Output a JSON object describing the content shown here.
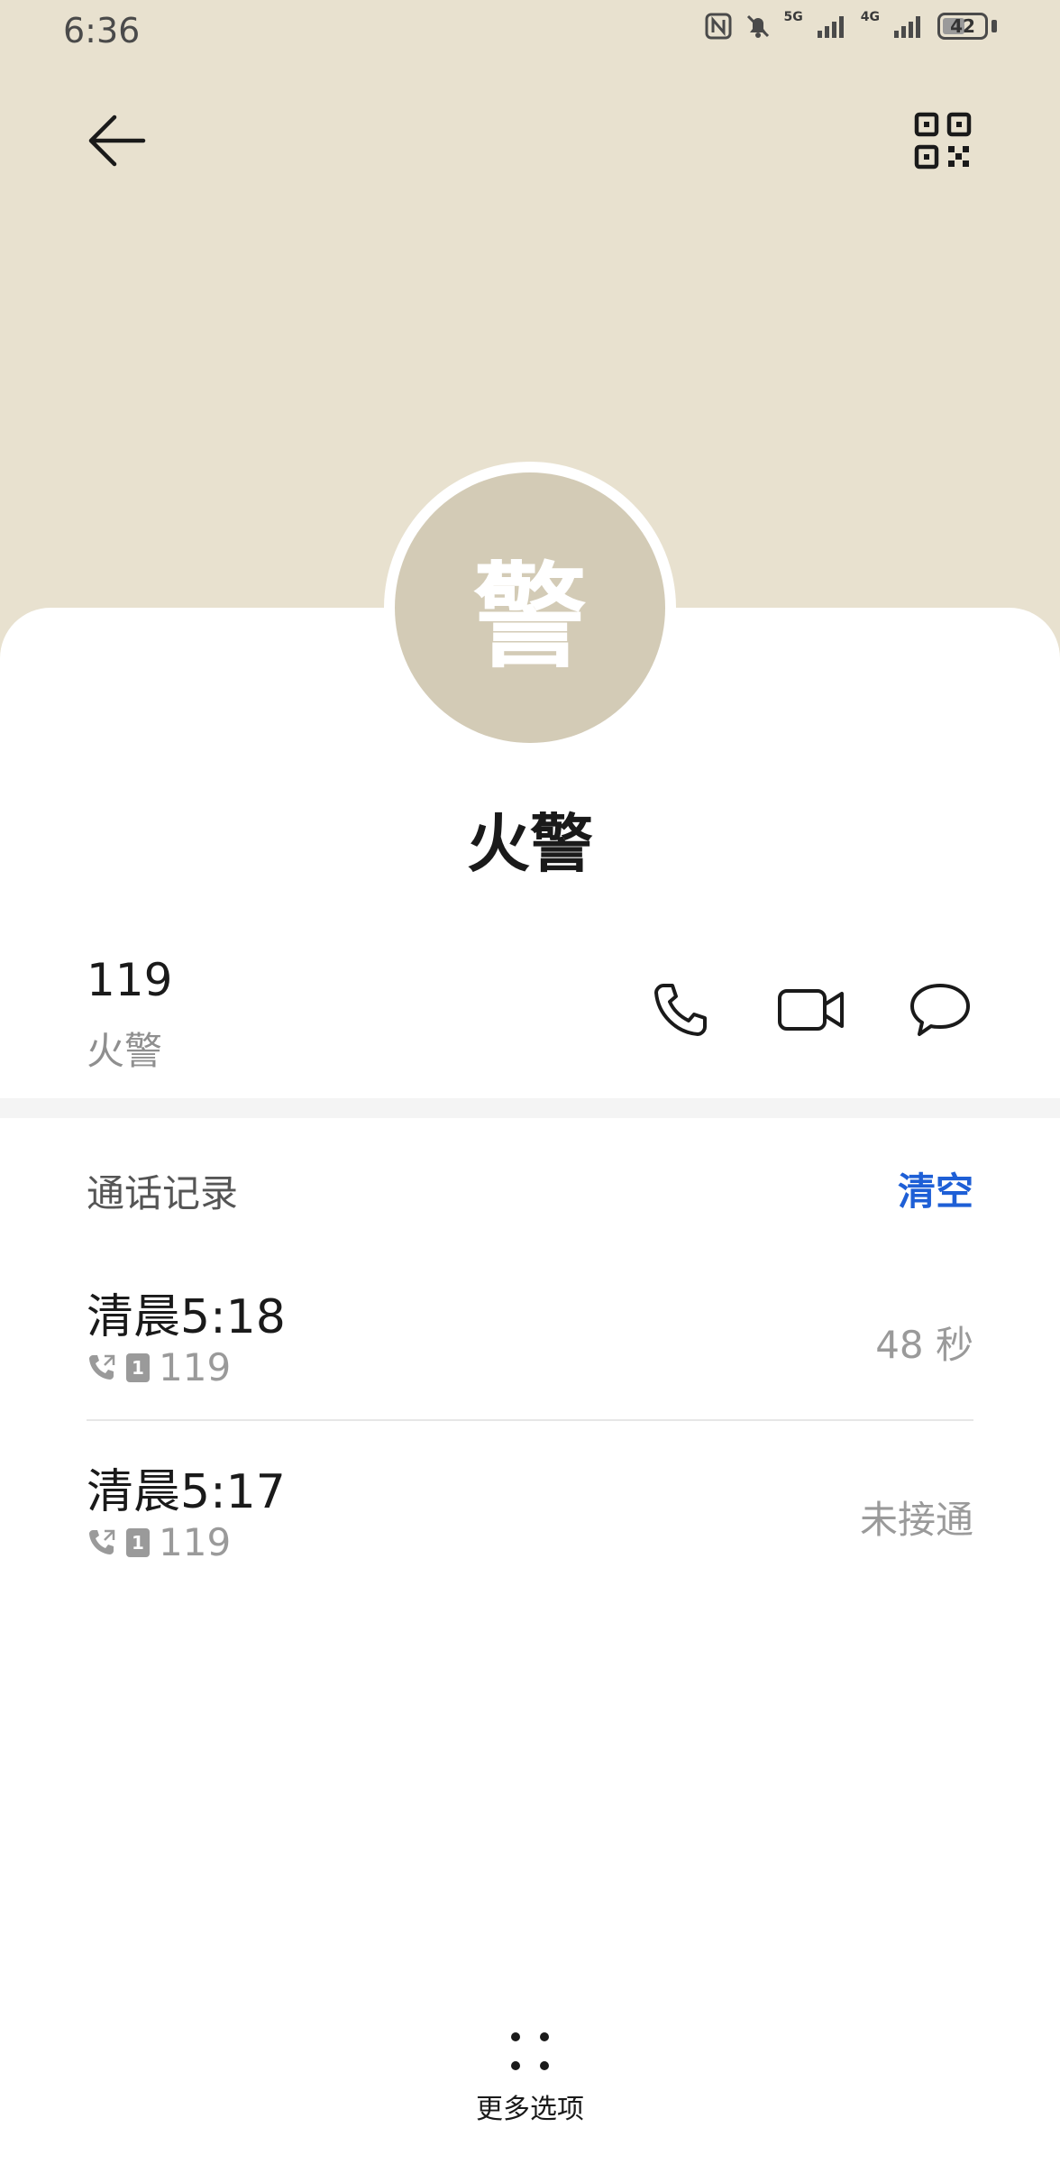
{
  "status_bar": {
    "time": "6:36",
    "network_1": "5G",
    "network_2": "4G",
    "battery": "42"
  },
  "contact": {
    "avatar_char": "警",
    "name": "火警",
    "number": "119",
    "number_label": "火警"
  },
  "actions": {
    "call": "phone-icon",
    "video": "video-call-icon",
    "message": "message-icon"
  },
  "call_log": {
    "title": "通话记录",
    "clear_label": "清空",
    "entries": [
      {
        "time": "清晨5:18",
        "sim": "1",
        "number": "119",
        "status": "48 秒"
      },
      {
        "time": "清晨5:17",
        "sim": "1",
        "number": "119",
        "status": "未接通"
      }
    ]
  },
  "footer": {
    "more_label": "更多选项"
  },
  "colors": {
    "header_bg": "#e8e1cf",
    "avatar_bg": "#d3cbb6",
    "accent": "#1e5fd6"
  }
}
